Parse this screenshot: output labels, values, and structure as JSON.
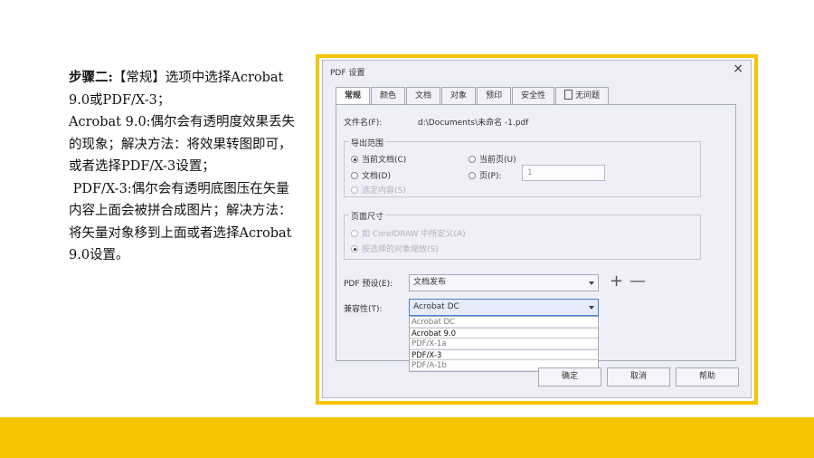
{
  "instructions": {
    "step_title": "步骤二:",
    "line1": "【常规】选项中选择Acrobat 9.0或PDF/X-3；",
    "line2": "Acrobat 9.0:偶尔会有透明度效果丢失的现象；解决方法：将效果转图即可，或者选择PDF/X-3设置；",
    "line3": " PDF/X-3:偶尔会有透明底图压在矢量内容上面会被拼合成图片；解决方法：将矢量对象移到上面或者选择Acrobat 9.0设置。"
  },
  "dialog": {
    "title": "PDF 设置",
    "close_icon": "×",
    "tabs": [
      "常规",
      "颜色",
      "文档",
      "对象",
      "预印",
      "安全性",
      "无问题"
    ],
    "active_tab": "常规",
    "filename_label": "文件名(F):",
    "filename_value": "d:\\Documents\\未命名 -1.pdf",
    "export_range": {
      "title": "导出范围",
      "current_doc": "当前文档(C)",
      "current_page": "当前页(U)",
      "documents": "文档(D)",
      "pages": "页(P):",
      "pages_value": "1",
      "selection": "选定内容(S)"
    },
    "page_size": {
      "title": "页面尺寸",
      "as_defined": "如 CorelDRAW 中所定义(A)",
      "fit_objects": "按选择的对象缩放(S)"
    },
    "preset_label": "PDF 预设(E):",
    "preset_value": "文档发布",
    "plus_icon": "+",
    "minus_icon": "—",
    "compat_label": "兼容性(T):",
    "compat_value": "Acrobat DC",
    "compat_options": [
      "Acrobat DC",
      "Acrobat 9.0",
      "PDF/X-1a",
      "PDF/X-3",
      "PDF/A-1b"
    ],
    "highlighted_options": [
      "Acrobat 9.0",
      "PDF/X-3"
    ],
    "ok": "确定",
    "cancel": "取消",
    "help": "帮助"
  },
  "colors": {
    "accent_yellow": "#f7c400",
    "dialog_bg": "#eeeef7",
    "focus_blue": "#4a7fd4"
  }
}
